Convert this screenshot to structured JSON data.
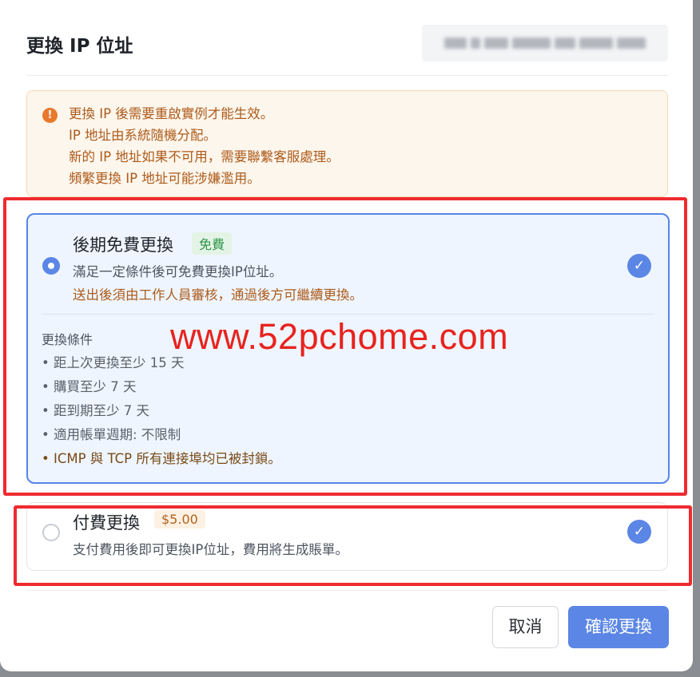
{
  "dialog": {
    "title": "更換 IP 位址"
  },
  "notice": {
    "lines": [
      "更換 IP 後需要重啟實例才能生效。",
      "IP 地址由系統隨機分配。",
      "新的 IP 地址如果不可用，需要聯繫客服處理。",
      "頻繁更換 IP 地址可能涉嫌濫用。"
    ]
  },
  "options": [
    {
      "title": "後期免費更換",
      "badge": "免費",
      "desc": "滿足一定條件後可免費更換IP位址。",
      "note": "送出後須由工作人員審核，通過後方可繼續更換。",
      "selected": true,
      "conditions_heading": "更換條件",
      "conditions": [
        "• 距上次更換至少 15 天",
        "• 購買至少 7 天",
        "• 距到期至少 7 天",
        "• 適用帳單週期: 不限制",
        "• ICMP 與 TCP 所有連接埠均已被封鎖。"
      ]
    },
    {
      "title": "付費更換",
      "badge": "$5.00",
      "desc": "支付費用後即可更換IP位址，費用將生成賬單。",
      "selected": false
    }
  ],
  "watermark": "www.52pchome.com",
  "buttons": {
    "cancel": "取消",
    "confirm": "確認更換"
  },
  "colors": {
    "accent": "#5b86e5",
    "warning": "#e9792d",
    "highlight": "#ee2b30"
  }
}
